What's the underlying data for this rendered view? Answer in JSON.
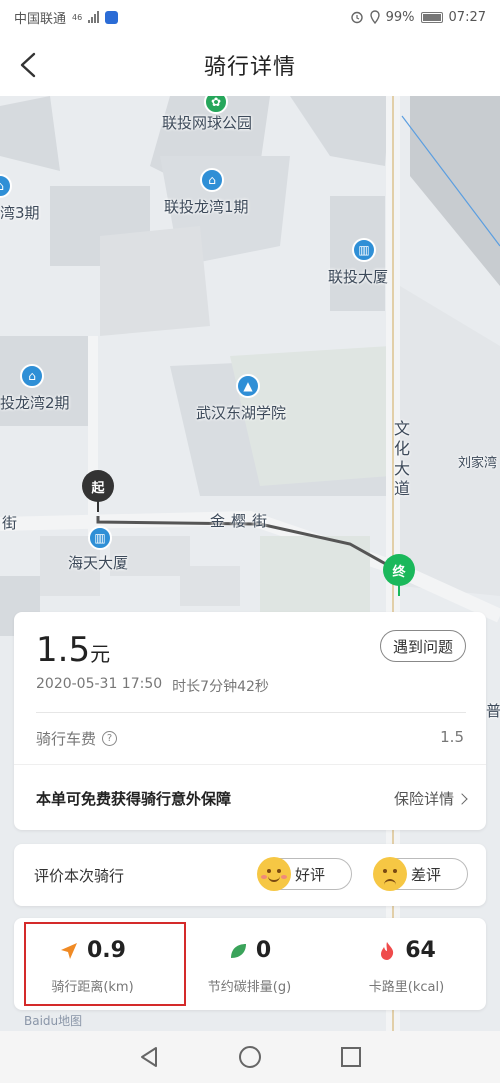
{
  "status_bar": {
    "carrier": "中国联通",
    "network": "46",
    "alarm_icon": "alarm-icon",
    "battery": "99%",
    "time": "07:27"
  },
  "header": {
    "title": "骑行详情",
    "back_icon": "back-arrow-icon"
  },
  "map": {
    "labels": {
      "tennis_park": "联投网球公园",
      "longwan_1": "联投龙湾1期",
      "longwan_3": "湾3期",
      "lt_building": "联投大厦",
      "longwan_2": "投龙湾2期",
      "wh_college": "武汉东湖学院",
      "wenhua_road": "文化大道",
      "liujiawan": "刘家湾",
      "jie_left": "街",
      "jinying_street": "金樱街",
      "haitian_building": "海天大厦",
      "pu": "普",
      "baidu_map": "Baidu地图"
    },
    "start_marker": "起",
    "end_marker": "终",
    "colors": {
      "route": "#555555",
      "end": "#1ab85b",
      "poi": "#2f8fd6"
    }
  },
  "fare": {
    "amount": "1.5",
    "unit": "元",
    "issue_button": "遇到问题",
    "datetime": "2020-05-31 17:50",
    "duration": "时长7分钟42秒",
    "fee_label": "骑行车费",
    "fee_value": "1.5",
    "insurance_text": "本单可免费获得骑行意外保障",
    "insurance_link": "保险详情"
  },
  "rating": {
    "title": "评价本次骑行",
    "good": "好评",
    "bad": "差评"
  },
  "stats": [
    {
      "icon": "direction-arrow-icon",
      "value": "0.9",
      "label": "骑行距离(km)",
      "color": "#f08a24"
    },
    {
      "icon": "leaf-icon",
      "value": "0",
      "label": "节约碳排量(g)",
      "color": "#3aa35a"
    },
    {
      "icon": "flame-icon",
      "value": "64",
      "label": "卡路里(kcal)",
      "color": "#ef4b4b"
    }
  ],
  "highlight_color": "#d42a2a"
}
